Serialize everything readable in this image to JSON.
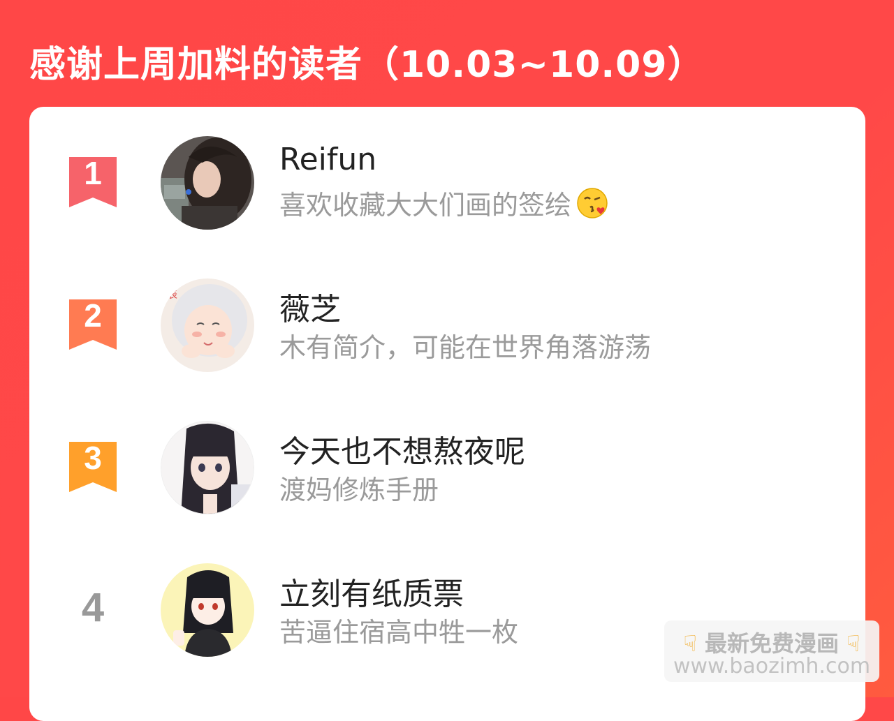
{
  "header": {
    "title": "感谢上周加料的读者（10.03~10.09）"
  },
  "colors": {
    "background": "#ff4848",
    "rank1": "#f6636a",
    "rank2": "#ff7b52",
    "rank3": "#ffa02b",
    "rank_other": "#999999",
    "name": "#222222",
    "bio": "#9a9a9a"
  },
  "readers": [
    {
      "rank": "1",
      "name": "Reifun",
      "bio": "喜欢收藏大大们画的签绘",
      "emoji": "kissing-face-icon"
    },
    {
      "rank": "2",
      "name": "薇芝",
      "bio": "木有简介，可能在世界角落游荡"
    },
    {
      "rank": "3",
      "name": "今天也不想熬夜呢",
      "bio": "渡妈修炼手册"
    },
    {
      "rank": "4",
      "name": "立刻有纸质票",
      "bio": "苦逼住宿高中牲一枚"
    }
  ],
  "watermark": {
    "line1": "最新免费漫画",
    "line2": "www.baozimh.com"
  }
}
